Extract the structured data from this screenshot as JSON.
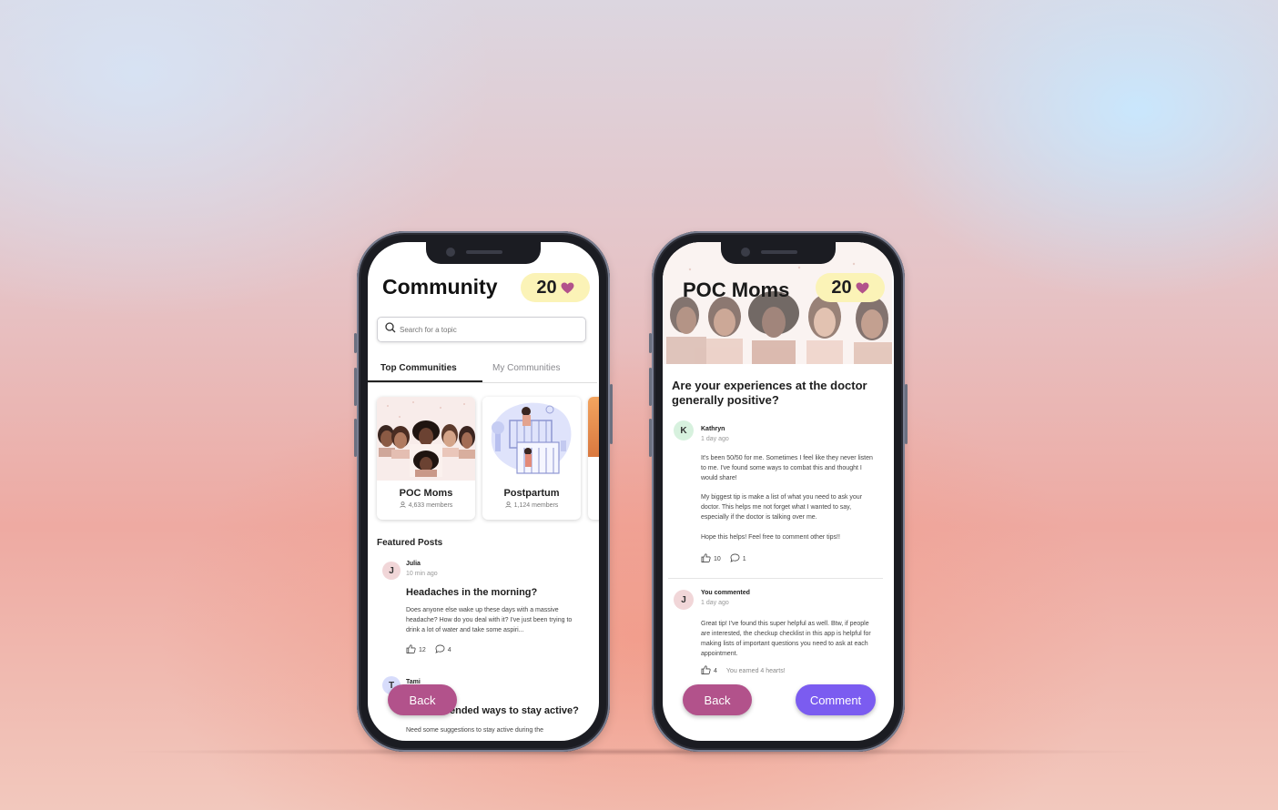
{
  "colors": {
    "heart": "#b2528b",
    "back_button": "#b2528b",
    "comment_button": "#7b5cf0",
    "hearts_pill": "#fbf3b7"
  },
  "community_screen": {
    "title": "Community",
    "hearts_count": "20",
    "search_placeholder": "Search for a topic",
    "tabs": [
      {
        "label": "Top Communities",
        "active": true
      },
      {
        "label": "My Communities",
        "active": false
      }
    ],
    "communities": [
      {
        "name": "POC Moms",
        "members": "4,633 members"
      },
      {
        "name": "Postpartum",
        "members": "1,124 members"
      }
    ],
    "featured_title": "Featured Posts",
    "posts": [
      {
        "initial": "J",
        "author": "Julia",
        "time": "10 min ago",
        "title": "Headaches in the morning?",
        "body": "Does anyone else wake up these days with a massive headache? How do you deal with it? I've just been trying to drink a lot of water and take some aspiri...",
        "likes": "12",
        "comments": "4"
      },
      {
        "initial": "T",
        "author": "Tami",
        "title_visible": "ended ways to stay active?",
        "body": "Need some suggestions to stay active during the"
      }
    ],
    "back_label": "Back"
  },
  "community_detail_screen": {
    "title": "POC Moms",
    "hearts_count": "20",
    "question": "Are your experiences at the doctor generally positive?",
    "post": {
      "initial": "K",
      "author": "Kathryn",
      "time": "1 day ago",
      "paragraphs": [
        "It's been 50/50 for me. Sometimes I feel like they never listen to me. I've found some ways to combat this and thought I would share!",
        "My biggest tip is make a list of what you need to ask your doctor. This helps me not forget what I wanted to say, especially if the doctor is talking over me.",
        "Hope this helps! Feel free to comment other tips!!"
      ],
      "likes": "10",
      "comments": "1"
    },
    "reply": {
      "initial": "J",
      "author": "You commented",
      "time": "1 day ago",
      "body": "Great tip! I've found this super helpful as well. Btw, if people are interested, the checkup checklist in this app is helpful for making lists of important questions you need to ask at each appointment.",
      "likes": "4",
      "earned": "You earned 4 hearts!"
    },
    "back_label": "Back",
    "comment_label": "Comment"
  }
}
